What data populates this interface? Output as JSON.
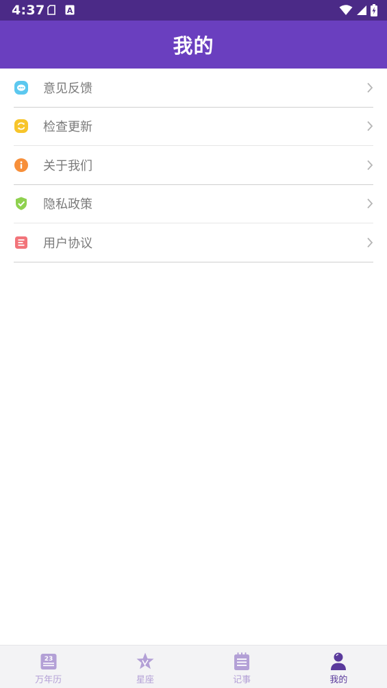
{
  "status_bar": {
    "time": "4:37",
    "icons_left": [
      "clipboard-icon",
      "a-badge-icon"
    ],
    "icons_right": [
      "wifi-icon",
      "cell-signal-icon",
      "battery-charging-icon"
    ]
  },
  "header": {
    "title": "我的"
  },
  "menu": {
    "items": [
      {
        "label": "意见反馈",
        "icon": "chat-bubble-icon",
        "color": "#5cc8ef"
      },
      {
        "label": "检查更新",
        "icon": "refresh-icon",
        "color": "#f7c52b"
      },
      {
        "label": "关于我们",
        "icon": "info-icon",
        "color": "#f78f3a"
      },
      {
        "label": "隐私政策",
        "icon": "shield-check-icon",
        "color": "#8fd14f"
      },
      {
        "label": "用户协议",
        "icon": "document-icon",
        "color": "#f2747a"
      }
    ]
  },
  "bottom_nav": {
    "items": [
      {
        "label": "万年历",
        "icon": "calendar-icon",
        "badge": "23",
        "active": false
      },
      {
        "label": "星座",
        "icon": "star-icon",
        "active": false
      },
      {
        "label": "记事",
        "icon": "notepad-icon",
        "active": false
      },
      {
        "label": "我的",
        "icon": "user-icon",
        "active": true
      }
    ]
  },
  "colors": {
    "status_bar": "#4b2a87",
    "app_bar": "#6a3fbf",
    "nav_inactive": "#b3a0d6",
    "nav_active": "#5a3a9c"
  }
}
